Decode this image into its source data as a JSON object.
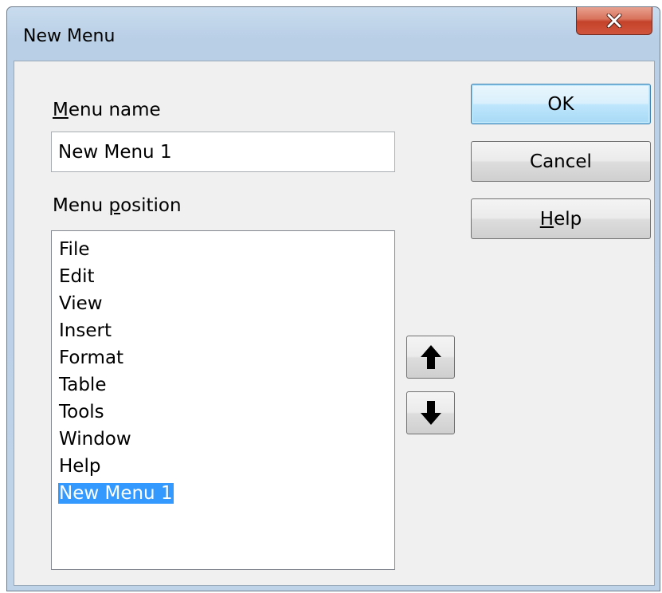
{
  "window": {
    "title": "New Menu"
  },
  "menu_name": {
    "label_accel": "M",
    "label_rest": "enu name",
    "value": "New Menu 1"
  },
  "menu_position": {
    "label_pre": "Menu ",
    "label_accel": "p",
    "label_post": "osition",
    "items": [
      {
        "label": "File"
      },
      {
        "label": "Edit"
      },
      {
        "label": "View"
      },
      {
        "label": "Insert"
      },
      {
        "label": "Format"
      },
      {
        "label": "Table"
      },
      {
        "label": "Tools"
      },
      {
        "label": "Window"
      },
      {
        "label": "Help"
      },
      {
        "label": "New Menu 1"
      }
    ],
    "selected_index": 9
  },
  "buttons": {
    "ok": "OK",
    "cancel": "Cancel",
    "help_accel": "H",
    "help_rest": "elp"
  },
  "icons": {
    "close": "close-icon",
    "move_up": "arrow-up-icon",
    "move_down": "arrow-down-icon"
  },
  "colors": {
    "selection": "#3399ff",
    "close_button": "#c4422a"
  }
}
